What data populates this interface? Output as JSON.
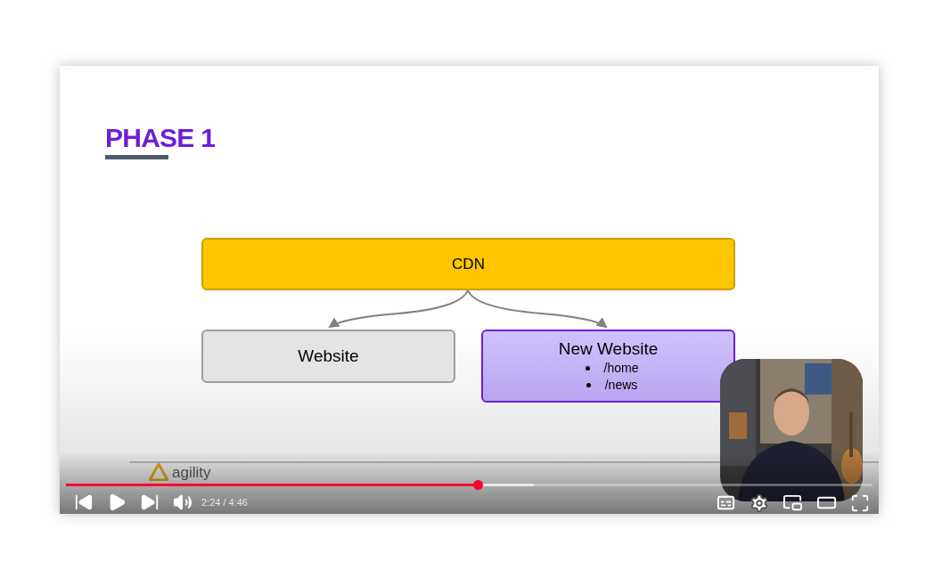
{
  "slide": {
    "title": "PHASE 1",
    "nodes": [
      {
        "kind": "cdn",
        "label": "CDN"
      },
      {
        "kind": "plain",
        "label": "Website"
      },
      {
        "kind": "highlight",
        "label": "New Website",
        "bullets": [
          "/home",
          "/news"
        ]
      }
    ],
    "logo": "agility"
  },
  "player": {
    "progress": {
      "level": 0.51
    },
    "buffer": {
      "level": 0.58
    },
    "time": "2:24 / 4:46"
  }
}
